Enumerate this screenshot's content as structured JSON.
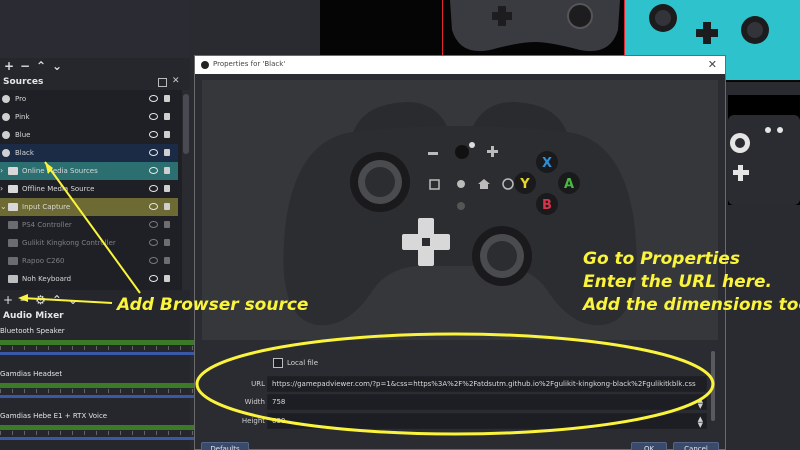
{
  "sources": {
    "header": "Sources",
    "items": [
      {
        "label": "Pro"
      },
      {
        "label": "Pink"
      },
      {
        "label": "Blue"
      },
      {
        "label": "Black"
      },
      {
        "label": "Online Media Sources"
      },
      {
        "label": "Offline Media Source"
      },
      {
        "label": "Input Capture"
      },
      {
        "label": "PS4 Controller"
      },
      {
        "label": "Gulikit Kingkong Controller"
      },
      {
        "label": "Rapoo C260"
      },
      {
        "label": "Noh Keyboard"
      }
    ]
  },
  "audio_mixer": {
    "header": "Audio Mixer",
    "channels": [
      {
        "label": "Bluetooth Speaker"
      },
      {
        "label": "Gamdias Headset"
      },
      {
        "label": "Gamdias Hebe E1 + RTX Voice"
      }
    ]
  },
  "dialog": {
    "title": "Properties for 'Black'",
    "close_label": "✕",
    "local_file_label": "Local file",
    "url_label": "URL",
    "url_value": "https://gamepadviewer.com/?p=1&css=https%3A%2F%2Fatdsutm.github.io%2Fgulikit-kingkong-black%2Fgulikitkblk.css",
    "width_label": "Width",
    "width_value": "758",
    "height_label": "Height",
    "height_value": "630",
    "defaults_label": "Defaults",
    "ok_label": "OK",
    "cancel_label": "Cancel"
  },
  "controller_buttons": {
    "x": "X",
    "y": "Y",
    "a": "A",
    "b": "B"
  },
  "annotations": {
    "add_source": "Add Browser source",
    "line1": "Go to Properties",
    "line2": "Enter the URL here.",
    "line3": "Add the dimensions too."
  },
  "colors": {
    "annotation": "#fbf43c",
    "selected_source": "#1b2a45",
    "online_group": "#2c6f70",
    "input_group": "#6d6b33",
    "teal_controller": "#2ec3cc",
    "x_button": "#2d8fd6",
    "y_button": "#e8d62a",
    "a_button": "#49b845",
    "b_button": "#d8334a"
  }
}
